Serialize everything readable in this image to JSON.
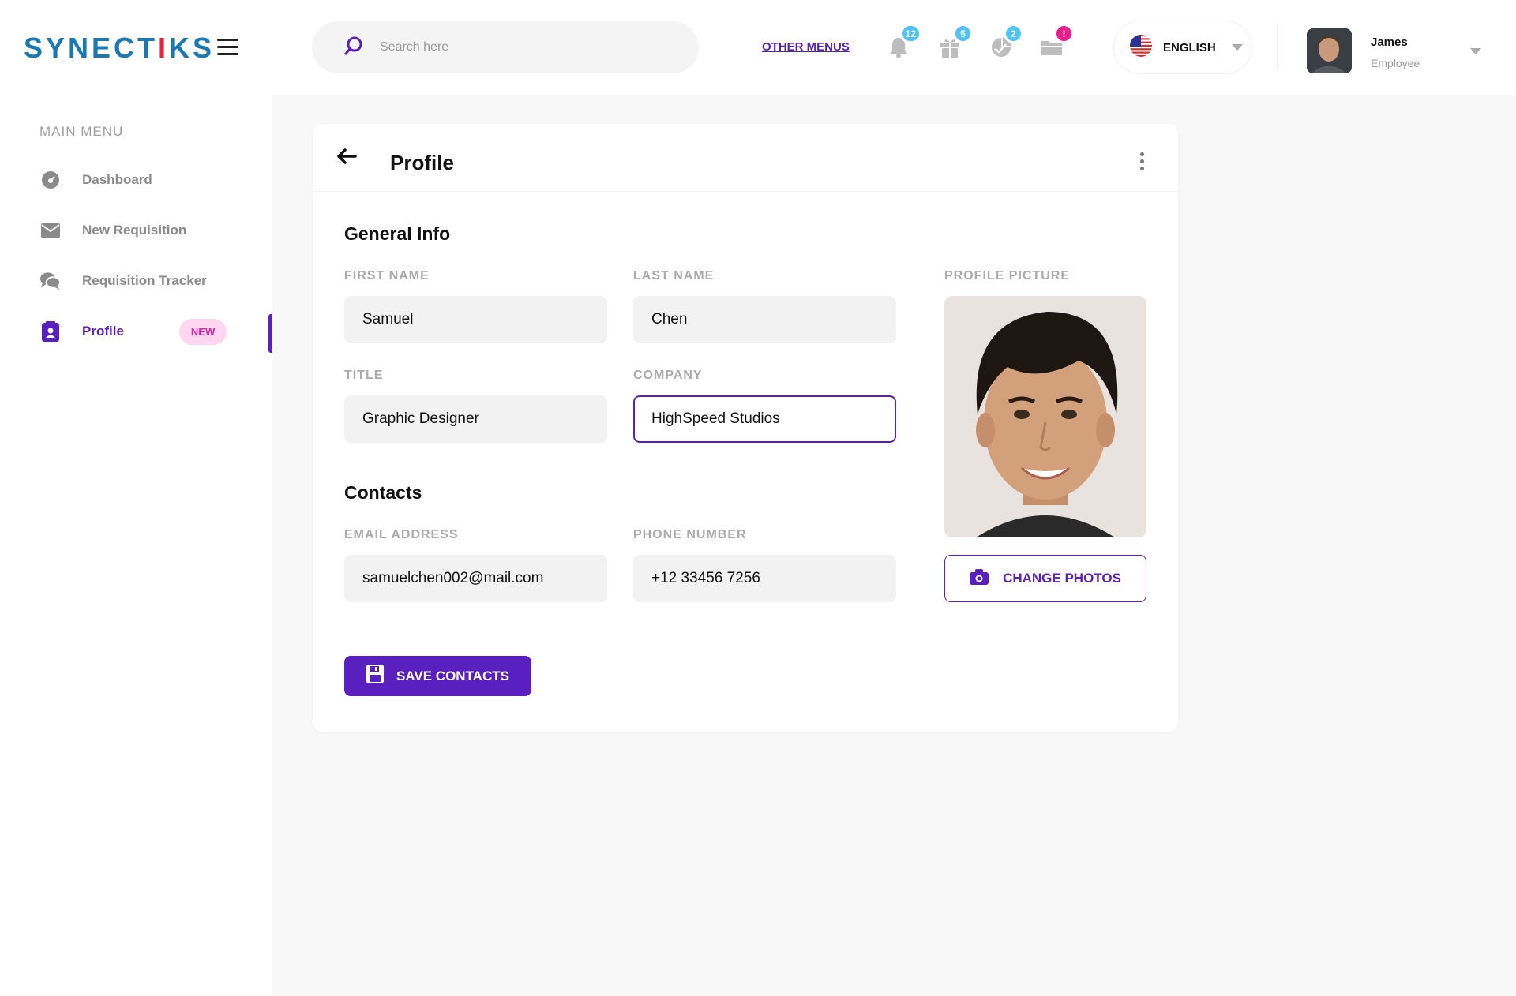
{
  "brand": {
    "part1": "SYNECT",
    "part2": "I",
    "part3": "KS"
  },
  "sidebar": {
    "heading": "MAIN MENU",
    "items": [
      {
        "label": "Dashboard",
        "icon": "dashboard-icon"
      },
      {
        "label": "New Requisition",
        "icon": "envelope-icon"
      },
      {
        "label": "Requisition Tracker",
        "icon": "chat-bubbles-icon"
      },
      {
        "label": "Profile",
        "icon": "profile-card-icon",
        "badge": "NEW",
        "active": true
      }
    ]
  },
  "header": {
    "search_placeholder": "Search here",
    "other_menus": "OTHER MENUS",
    "notifications": [
      {
        "icon": "bell-icon",
        "count": "12",
        "color": "#4fc3f7"
      },
      {
        "icon": "gift-icon",
        "count": "5",
        "color": "#4fc3f7"
      },
      {
        "icon": "chart-icon",
        "count": "2",
        "color": "#4fc3f7"
      },
      {
        "icon": "folder-icon",
        "count": "!",
        "color": "#e91e8c"
      }
    ],
    "language": "ENGLISH",
    "user": {
      "name": "James",
      "role": "Employee"
    }
  },
  "profile": {
    "title": "Profile",
    "general_info_title": "General Info",
    "first_name_label": "FIRST NAME",
    "first_name": "Samuel",
    "last_name_label": "LAST NAME",
    "last_name": "Chen",
    "title_label": "TITLE",
    "job_title": "Graphic Designer",
    "company_label": "COMPANY",
    "company": "HighSpeed Studios",
    "contacts_title": "Contacts",
    "email_label": "EMAIL ADDRESS",
    "email": "samuelchen002@mail.com",
    "phone_label": "PHONE NUMBER",
    "phone": "+12 33456 7256",
    "picture_label": "PROFILE PICTURE",
    "change_photos": "CHANGE PHOTOS",
    "save_contacts": "SAVE CONTACTS"
  },
  "colors": {
    "accent": "#5a1fbf",
    "brand_blue": "#1a78b4",
    "brand_red": "#e8253f"
  }
}
